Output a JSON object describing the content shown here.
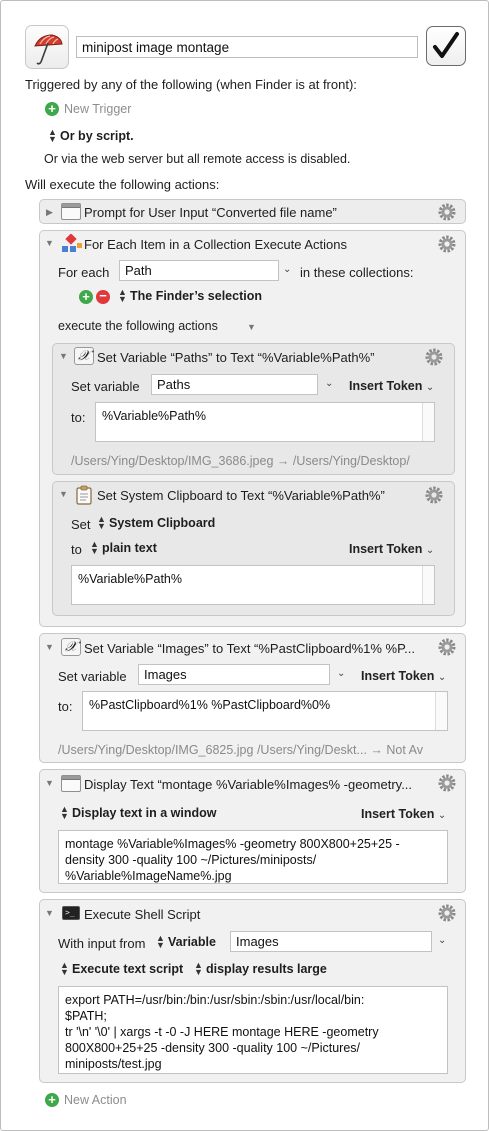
{
  "macro": {
    "name": "minipost image montage",
    "enabled_icon": "checkmark-icon",
    "app_icon": "umbrella-icon"
  },
  "triggers": {
    "heading": "Triggered by any of the following (when Finder is at front):",
    "new_trigger": "New Trigger",
    "or_by_script": "Or by script.",
    "web_server": "Or via the web server but all remote access is disabled."
  },
  "actions_heading": "Will execute the following actions:",
  "actions": {
    "prompt": {
      "title": "Prompt for User Input “Converted file name”"
    },
    "foreach": {
      "title": "For Each Item in a Collection Execute Actions",
      "for_each_label": "For each",
      "variable": "Path",
      "in_collections_label": "in these collections:",
      "collection": "The Finder’s selection",
      "execute_label": "execute the following actions",
      "setvar": {
        "title": "Set Variable “Paths” to Text “%Variable%Path%”",
        "set_variable_label": "Set variable",
        "variable": "Paths",
        "insert_token": "Insert Token",
        "to_label": "to:",
        "value": "%Variable%Path%",
        "preview": "/Users/Ying/Desktop/IMG_3686.jpeg → /Users/Ying/Desktop/"
      },
      "clipboard": {
        "title": "Set System Clipboard to Text “%Variable%Path%”",
        "set_label": "Set",
        "target": "System Clipboard",
        "to_label": "to",
        "format": "plain text",
        "insert_token": "Insert Token",
        "value": "%Variable%Path%"
      }
    },
    "setimages": {
      "title": "Set Variable “Images” to Text “%PastClipboard%1% %P...",
      "set_variable_label": "Set variable",
      "variable": "Images",
      "insert_token": "Insert Token",
      "to_label": "to:",
      "value": "%PastClipboard%1% %PastClipboard%0%",
      "preview": "/Users/Ying/Desktop/IMG_6825.jpg /Users/Ying/Deskt... → Not Av"
    },
    "display": {
      "title": "Display Text “montage %Variable%Images% -geometry...",
      "mode": "Display text in a window",
      "insert_token": "Insert Token",
      "lines": [
        "montage %Variable%Images% -geometry 800X800+25+25 -",
        "density 300 -quality 100 ~/Pictures/miniposts/",
        "%Variable%ImageName%.jpg"
      ]
    },
    "shell": {
      "title": "Execute Shell Script",
      "with_input_label": "With input from",
      "input_source": "Variable",
      "input_variable": "Images",
      "execute_mode": "Execute text script",
      "results_mode": "display results large",
      "lines": [
        "export PATH=/usr/bin:/bin:/usr/sbin:/sbin:/usr/local/bin:",
        "$PATH;",
        "tr '\\n' '\\0' | xargs -t -0 -J HERE montage HERE -geometry",
        "800X800+25+25 -density 300 -quality 100 ~/Pictures/",
        "miniposts/test.jpg"
      ]
    }
  },
  "new_action": "New Action",
  "colors": {
    "add_green": "#3ea84b",
    "remove_red": "#e0383b",
    "group_bg": "#ededed",
    "border": "#c8c8c8"
  }
}
